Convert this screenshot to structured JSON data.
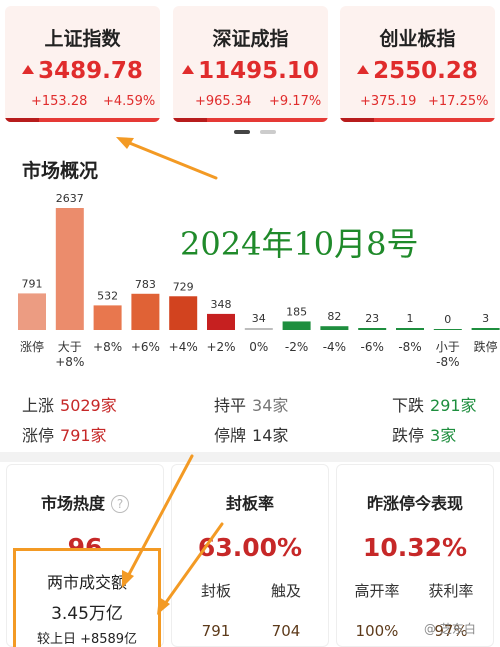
{
  "indices": [
    {
      "name": "上证指数",
      "value": "3489.78",
      "change": "+153.28",
      "pct": "+4.59%"
    },
    {
      "name": "深证成指",
      "value": "11495.10",
      "change": "+965.34",
      "pct": "+9.17%"
    },
    {
      "name": "创业板指",
      "value": "2550.28",
      "change": "+375.19",
      "pct": "+17.25%"
    }
  ],
  "overview": {
    "title": "市场概况",
    "annotation_date": "2024年10月8号",
    "stats": {
      "up_label": "上涨",
      "up_value": "5029家",
      "flat_label": "持平",
      "flat_value": "34家",
      "down_label": "下跌",
      "down_value": "291家",
      "limit_up_label": "涨停",
      "limit_up_value": "791家",
      "suspended_label": "停牌",
      "suspended_value": "14家",
      "limit_down_label": "跌停",
      "limit_down_value": "3家"
    }
  },
  "chart_data": {
    "type": "bar",
    "categories": [
      "涨停",
      "大于+8%",
      "+8%",
      "+6%",
      "+4%",
      "+2%",
      "0%",
      "-2%",
      "-4%",
      "-6%",
      "-8%",
      "小于-8%",
      "跌停"
    ],
    "values": [
      791,
      2637,
      532,
      783,
      729,
      348,
      34,
      185,
      82,
      23,
      1,
      0,
      3
    ],
    "colors": [
      "#ec9c82",
      "#eb8c6c",
      "#e8774e",
      "#e06236",
      "#d2431f",
      "#c62020",
      "#bdbdbd",
      "#1e8e3e",
      "#1e8e3e",
      "#1e8e3e",
      "#1e8e3e",
      "#1e8e3e",
      "#1e8e3e"
    ],
    "title": "",
    "xlabel": "",
    "ylabel": ""
  },
  "heat": {
    "title": "市场热度",
    "score": "96",
    "turnover_label": "两市成交额",
    "turnover_value": "3.45万亿",
    "turnover_change": "较上日 +8589亿"
  },
  "seal": {
    "title": "封板率",
    "rate": "63.00%",
    "seal_label": "封板",
    "seal_value": "791",
    "touch_label": "触及",
    "touch_value": "704"
  },
  "yesterday": {
    "title": "昨涨停今表现",
    "rate": "10.32%",
    "open_high_label": "高开率",
    "open_high_value": "100%",
    "profit_label": "获利率",
    "profit_value": "97%"
  },
  "watermark": "@ 芝东白"
}
